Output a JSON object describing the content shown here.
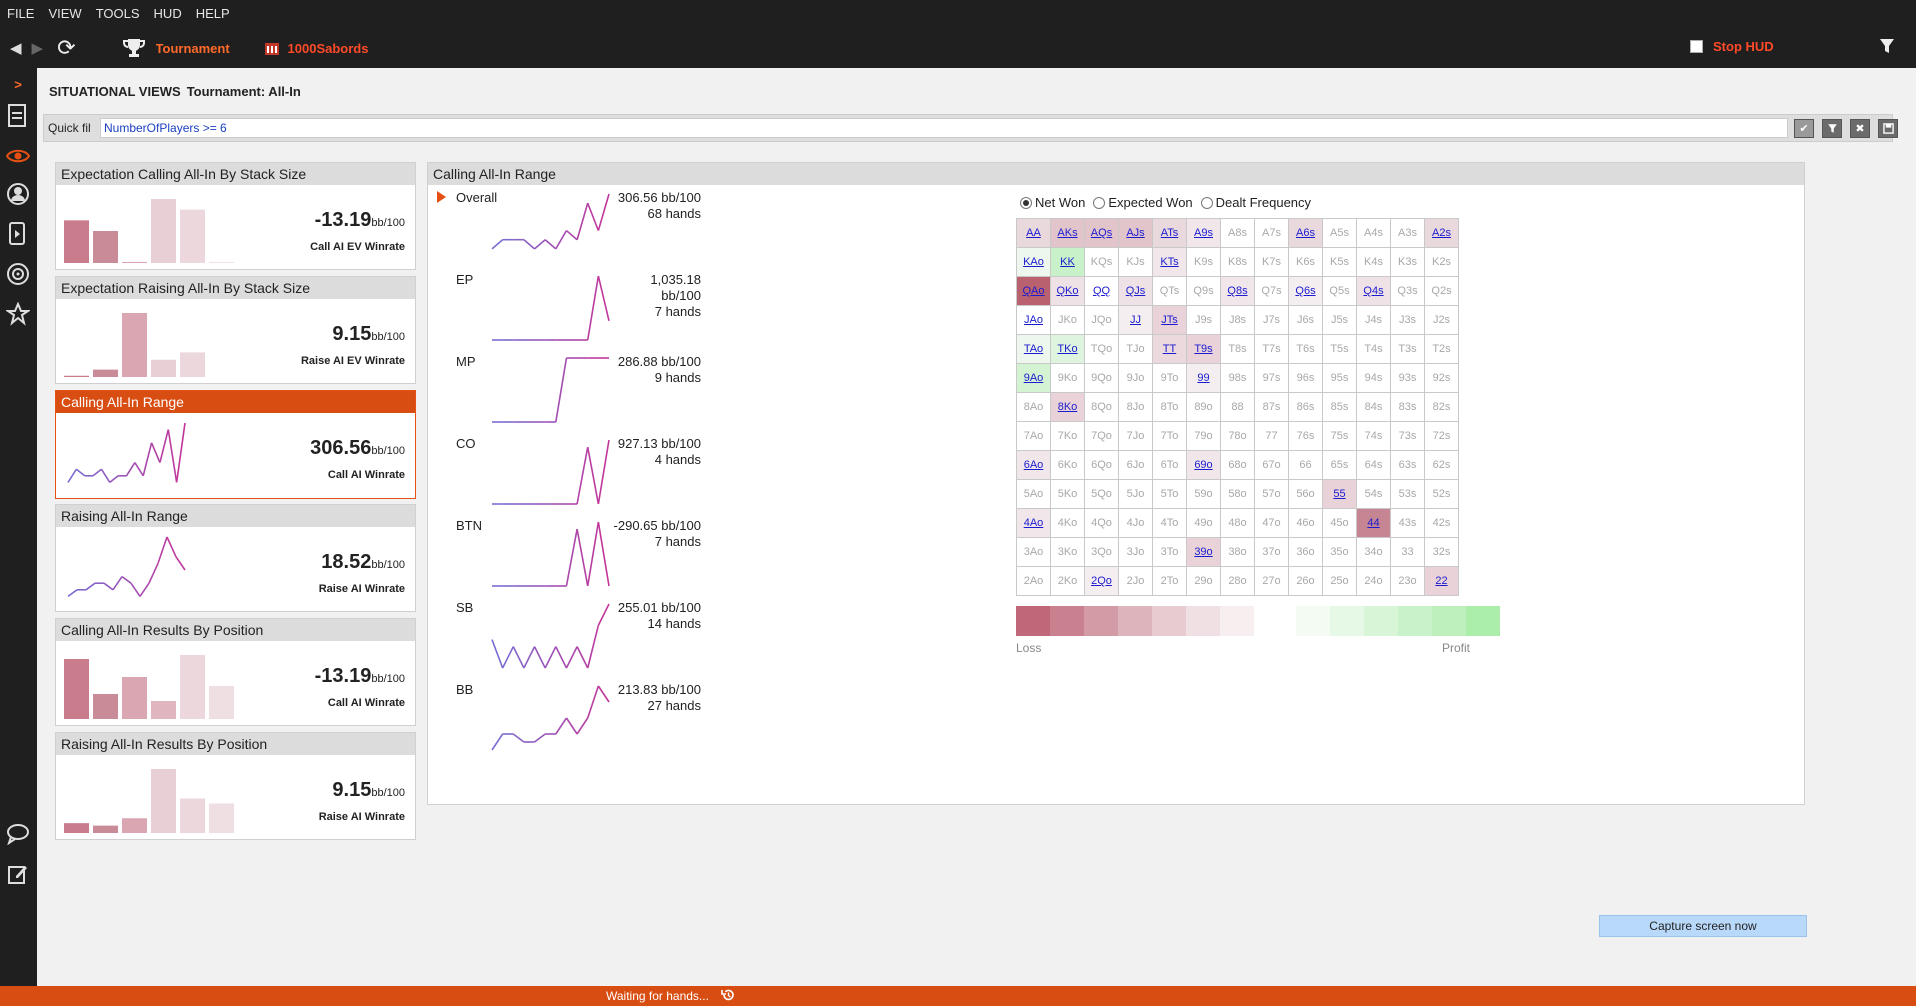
{
  "menu": [
    "FILE",
    "VIEW",
    "TOOLS",
    "HUD",
    "HELP"
  ],
  "toolbar": {
    "tournament_label": "Tournament",
    "player_name": "1000Sabords",
    "stop_hud_label": "Stop HUD",
    "stop_hud_checked": false
  },
  "page": {
    "title": "SITUATIONAL VIEWS",
    "subtitle": "Tournament: All-In"
  },
  "quick_filter": {
    "label": "Quick filter",
    "value": "NumberOfPlayers >= 6"
  },
  "panels": [
    {
      "title": "Expectation Calling All-In By Stack Size",
      "value": "-13.19",
      "unit": "bb/100",
      "caption": "Call AI EV Winrate",
      "chart": "bar",
      "bars": [
        4,
        3,
        0.1,
        6,
        5,
        0.1,
        0
      ],
      "bar_colors": [
        "#c87c8c",
        "#c98b98",
        "#d9a6b1",
        "#e8cfd5",
        "#ecd8dc",
        "#efe1e4",
        "#f3e9eb"
      ],
      "active": false
    },
    {
      "title": "Expectation Raising All-In By Stack Size",
      "value": "9.15",
      "unit": "bb/100",
      "caption": "Raise AI EV Winrate",
      "chart": "bar",
      "bars": [
        0.1,
        0.6,
        5.2,
        1.4,
        2,
        0,
        0
      ],
      "bar_colors": [
        "#c87c8c",
        "#c98b98",
        "#d9a6b1",
        "#e8cfd5",
        "#ecd8dc",
        "#efe1e4",
        "#f3e9eb"
      ],
      "active": false
    },
    {
      "title": "Calling All-In Range",
      "value": "306.56",
      "unit": "bb/100",
      "caption": "Call AI Winrate",
      "chart": "line",
      "line": [
        1,
        3,
        2,
        2,
        3,
        1,
        2,
        2,
        4,
        2,
        7,
        4,
        9,
        1,
        10
      ],
      "active": true
    },
    {
      "title": "Raising All-In Range",
      "value": "18.52",
      "unit": "bb/100",
      "caption": "Raise AI Winrate",
      "chart": "line",
      "line": [
        1,
        2,
        2,
        3,
        3,
        2,
        4,
        3,
        1,
        3,
        6,
        10,
        7,
        5
      ],
      "active": false
    },
    {
      "title": "Calling All-In Results By Position",
      "value": "-13.19",
      "unit": "bb/100",
      "caption": "Call AI Winrate",
      "chart": "bar",
      "bars": [
        6,
        2.5,
        4.2,
        1.8,
        6.4,
        3.3,
        0
      ],
      "bar_colors": [
        "#c87c8c",
        "#c98b98",
        "#d9a6b1",
        "#e0b5bf",
        "#ecd8dc",
        "#efdfe3",
        "#f3e9eb"
      ],
      "active": false
    },
    {
      "title": "Raising All-In Results By Position",
      "value": "9.15",
      "unit": "bb/100",
      "caption": "Raise AI Winrate",
      "chart": "bar",
      "bars": [
        0.8,
        0.6,
        1.2,
        5.2,
        2.8,
        2.4,
        0
      ],
      "bar_colors": [
        "#c87c8c",
        "#c98b98",
        "#d9a6b1",
        "#e8cfd5",
        "#ecd8dc",
        "#efdfe3",
        "#f3e9eb"
      ],
      "active": false
    }
  ],
  "main": {
    "title": "Calling All-In Range",
    "positions": [
      {
        "name": "Overall",
        "winrate": "306.56 bb/100",
        "hands": "68 hands",
        "line": [
          1,
          2,
          2,
          2,
          1,
          2,
          1,
          3,
          2,
          6,
          3,
          7
        ]
      },
      {
        "name": "EP",
        "winrate": "1,035.18 bb/100",
        "hands": "7 hands",
        "line": [
          0,
          0,
          0,
          0,
          0,
          0,
          0,
          0,
          0,
          0,
          10,
          3
        ]
      },
      {
        "name": "MP",
        "winrate": "286.88 bb/100",
        "hands": "9 hands",
        "line": [
          0,
          0,
          0,
          0,
          0,
          0,
          0,
          10,
          10,
          10,
          10,
          10
        ]
      },
      {
        "name": "CO",
        "winrate": "927.13 bb/100",
        "hands": "4 hands",
        "line": [
          0,
          0,
          0,
          0,
          0,
          0,
          0,
          0,
          0,
          8,
          0,
          9
        ]
      },
      {
        "name": "BTN",
        "winrate": "-290.65 bb/100",
        "hands": "7 hands",
        "line": [
          0,
          0,
          0,
          0,
          0,
          0,
          0,
          0,
          8,
          0,
          9,
          0
        ]
      },
      {
        "name": "SB",
        "winrate": "255.01 bb/100",
        "hands": "14 hands",
        "line": [
          4,
          0,
          3,
          0,
          3,
          0,
          3,
          0,
          3,
          0,
          6,
          9
        ]
      },
      {
        "name": "BB",
        "winrate": "213.83 bb/100",
        "hands": "27 hands",
        "line": [
          0,
          2,
          2,
          1,
          1,
          2,
          2,
          4,
          2,
          4,
          8,
          6
        ]
      }
    ],
    "radio_options": [
      {
        "label": "Net Won",
        "checked": true
      },
      {
        "label": "Expected Won",
        "checked": false
      },
      {
        "label": "Dealt Frequency",
        "checked": false
      }
    ],
    "grid": [
      [
        "AA",
        "AKs",
        "AQs",
        "AJs",
        "ATs",
        "A9s",
        "A8s",
        "A7s",
        "A6s",
        "A5s",
        "A4s",
        "A3s",
        "A2s"
      ],
      [
        "KAo",
        "KK",
        "KQs",
        "KJs",
        "KTs",
        "K9s",
        "K8s",
        "K7s",
        "K6s",
        "K5s",
        "K4s",
        "K3s",
        "K2s"
      ],
      [
        "QAo",
        "QKo",
        "QQ",
        "QJs",
        "QTs",
        "Q9s",
        "Q8s",
        "Q7s",
        "Q6s",
        "Q5s",
        "Q4s",
        "Q3s",
        "Q2s"
      ],
      [
        "JAo",
        "JKo",
        "JQo",
        "JJ",
        "JTs",
        "J9s",
        "J8s",
        "J7s",
        "J6s",
        "J5s",
        "J4s",
        "J3s",
        "J2s"
      ],
      [
        "TAo",
        "TKo",
        "TQo",
        "TJo",
        "TT",
        "T9s",
        "T8s",
        "T7s",
        "T6s",
        "T5s",
        "T4s",
        "T3s",
        "T2s"
      ],
      [
        "9Ao",
        "9Ko",
        "9Qo",
        "9Jo",
        "9To",
        "99",
        "98s",
        "97s",
        "96s",
        "95s",
        "94s",
        "93s",
        "92s"
      ],
      [
        "8Ao",
        "8Ko",
        "8Qo",
        "8Jo",
        "8To",
        "89o",
        "88",
        "87s",
        "86s",
        "85s",
        "84s",
        "83s",
        "82s"
      ],
      [
        "7Ao",
        "7Ko",
        "7Qo",
        "7Jo",
        "7To",
        "79o",
        "78o",
        "77",
        "76s",
        "75s",
        "74s",
        "73s",
        "72s"
      ],
      [
        "6Ao",
        "6Ko",
        "6Qo",
        "6Jo",
        "6To",
        "69o",
        "68o",
        "67o",
        "66",
        "65s",
        "64s",
        "63s",
        "62s"
      ],
      [
        "5Ao",
        "5Ko",
        "5Qo",
        "5Jo",
        "5To",
        "59o",
        "58o",
        "57o",
        "56o",
        "55",
        "54s",
        "53s",
        "52s"
      ],
      [
        "4Ao",
        "4Ko",
        "4Qo",
        "4Jo",
        "4To",
        "49o",
        "48o",
        "47o",
        "46o",
        "45o",
        "44",
        "43s",
        "42s"
      ],
      [
        "3Ao",
        "3Ko",
        "3Qo",
        "3Jo",
        "3To",
        "39o",
        "38o",
        "37o",
        "36o",
        "35o",
        "34o",
        "33",
        "32s"
      ],
      [
        "2Ao",
        "2Ko",
        "2Qo",
        "2Jo",
        "2To",
        "29o",
        "28o",
        "27o",
        "26o",
        "25o",
        "24o",
        "23o",
        "22"
      ]
    ],
    "grid_active": [
      "AA",
      "AKs",
      "AQs",
      "AJs",
      "ATs",
      "A9s",
      "A6s",
      "A2s",
      "KAo",
      "KK",
      "KTs",
      "QAo",
      "QKo",
      "QQ",
      "QJs",
      "Q8s",
      "Q6s",
      "Q4s",
      "JAo",
      "JJ",
      "JTs",
      "TAo",
      "TKo",
      "TT",
      "T9s",
      "9Ao",
      "99",
      "8Ko",
      "6Ao",
      "69o",
      "55",
      "4Ao",
      "44",
      "39o",
      "2Qo",
      "22"
    ],
    "grid_colors": {
      "AA": "#e9d8dc",
      "AKs": "#e2c4cb",
      "AQs": "#e2c4cb",
      "AJs": "#e2c4cb",
      "ATs": "#e9d8dc",
      "A9s": "#f1e6e9",
      "A6s": "#e9d8dc",
      "A2s": "#e9d8dc",
      "KAo": "#edf7ed",
      "KK": "#c9f1c9",
      "KTs": "#f1e6e9",
      "QAo": "#b9616f",
      "QKo": "#efe2e6",
      "QJs": "#efe2e6",
      "Q8s": "#f1e6e9",
      "Q6s": "#f5eef0",
      "Q4s": "#efe2e6",
      "JJ": "#f5eef0",
      "JTs": "#e9d3d8",
      "TAo": "#edf7ed",
      "TKo": "#dff4df",
      "TT": "#ecd9dd",
      "T9s": "#ead3d8",
      "9Ao": "#d3f3d3",
      "99": "#f5eef0",
      "8Ko": "#ead3d8",
      "6Ao": "#f1e6e9",
      "69o": "#f1e6e9",
      "55": "#e9d3d8",
      "4Ao": "#f1e6e9",
      "44": "#c58593",
      "39o": "#e9d3d8",
      "2Qo": "#f5eef0",
      "22": "#e9d3d8"
    },
    "legend": {
      "loss_label": "Loss",
      "profit_label": "Profit",
      "loss_colors": [
        "#c0687a",
        "#c9818f",
        "#d39ba6",
        "#ddb3bc",
        "#e7cbd1",
        "#f0e0e3",
        "#f7eef0"
      ],
      "profit_colors": [
        "#f3fbf3",
        "#e6f8e6",
        "#d8f5d8",
        "#caf2ca",
        "#bdf0bd",
        "#aaeeaa"
      ]
    }
  },
  "capture_button": "Capture screen now",
  "status": {
    "text": "Waiting for hands..."
  }
}
